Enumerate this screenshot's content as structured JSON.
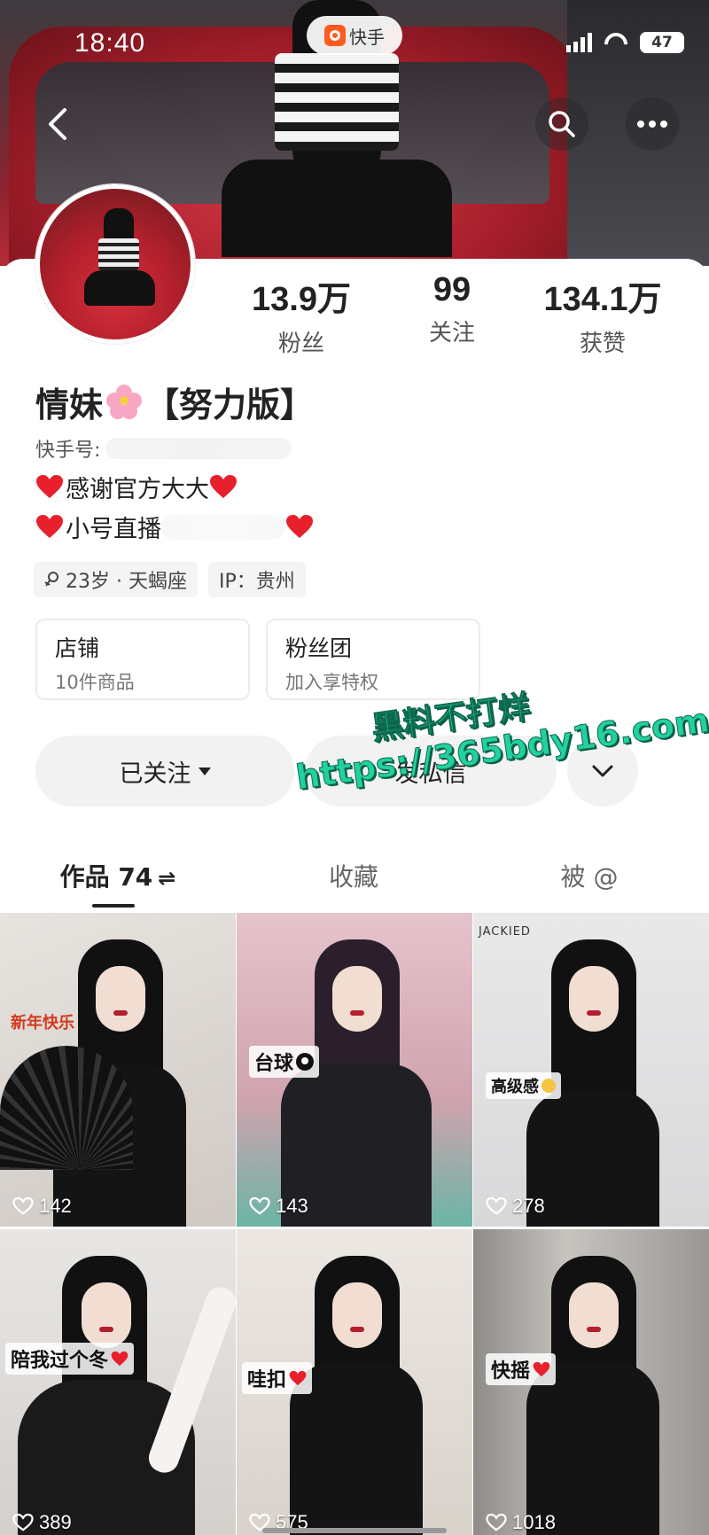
{
  "status_bar": {
    "time": "18:40",
    "app_pill": "快手",
    "battery": "47"
  },
  "profile": {
    "name_part1": "情妹",
    "name_part2": "【努力版】",
    "kuaishou_id_label": "快手号:",
    "bio_line1": "感谢官方大大",
    "bio_line2": "小号直播",
    "age_tag": "23岁 · 天蝎座",
    "ip_tag": "IP：贵州"
  },
  "stats": [
    {
      "value": "13.9万",
      "label": "粉丝"
    },
    {
      "value": "99",
      "label": "关注"
    },
    {
      "value": "134.1万",
      "label": "获赞"
    }
  ],
  "boxes": [
    {
      "title": "店铺",
      "subtitle": "10件商品"
    },
    {
      "title": "粉丝团",
      "subtitle": "加入享特权"
    }
  ],
  "actions": {
    "follow": "已关注",
    "message": "发私信"
  },
  "watermark": {
    "line1": "黑料不打烊",
    "line2": "https://365bdy16.com"
  },
  "tabs": [
    {
      "label": "作品 74",
      "swap": "⇌"
    },
    {
      "label": "收藏"
    },
    {
      "label": "被 @"
    }
  ],
  "videos": [
    {
      "likes": "142",
      "overlay": "",
      "extra": "新年快乐"
    },
    {
      "likes": "143",
      "overlay": "台球"
    },
    {
      "likes": "278",
      "overlay": "高级感",
      "extra": "JACKIED"
    },
    {
      "likes": "389",
      "overlay": "陪我过个冬"
    },
    {
      "likes": "575",
      "overlay": "哇扣"
    },
    {
      "likes": "1018",
      "overlay": "快摇"
    }
  ],
  "colors": {
    "accent_watermark": "#22d1a0",
    "heart": "#e8202c",
    "banner_red": "#b52a36"
  }
}
